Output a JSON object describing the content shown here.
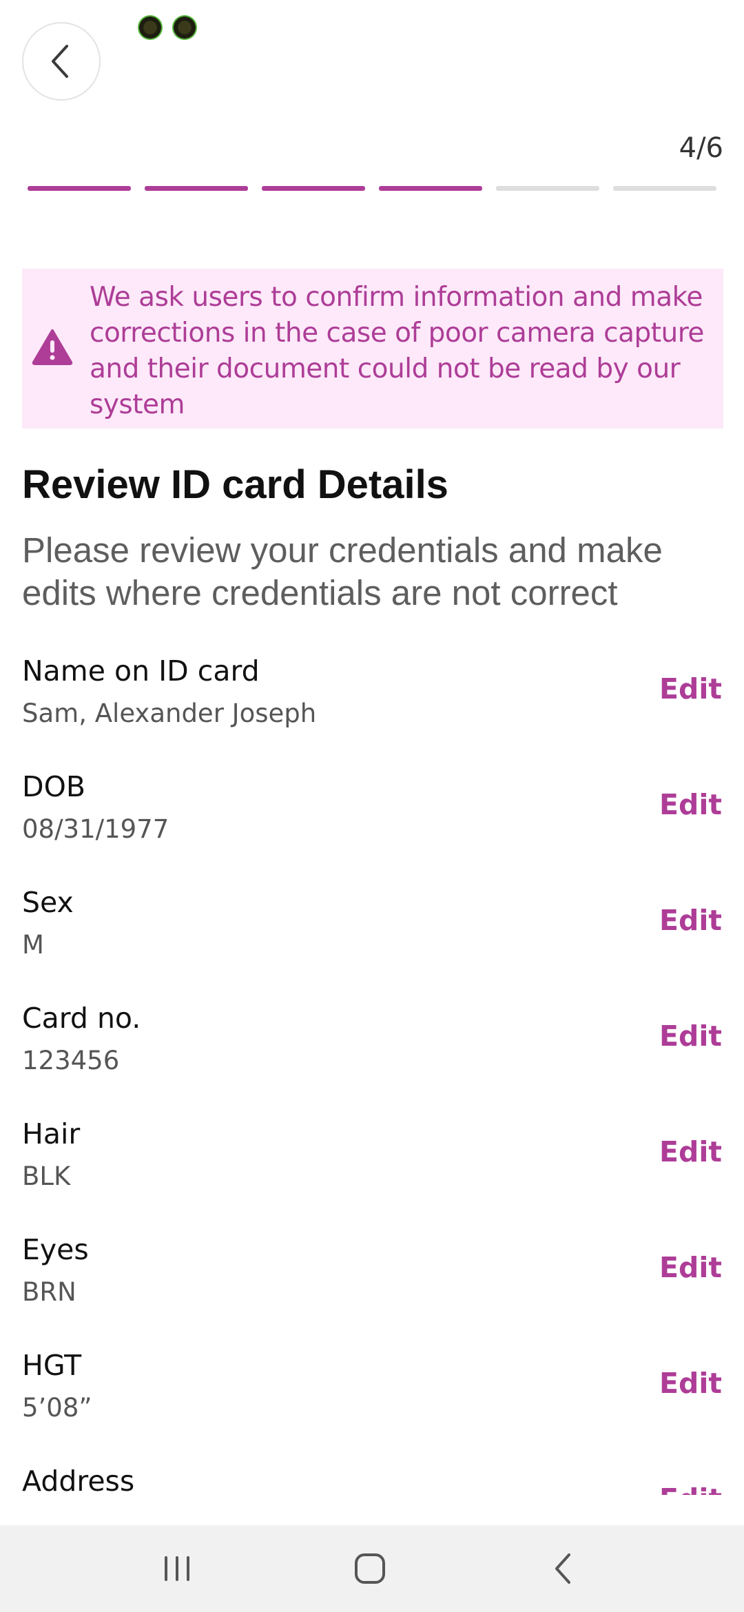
{
  "header": {
    "step_counter": "4/6",
    "progress": {
      "total_steps": 6,
      "completed_steps": 4
    }
  },
  "notice": {
    "icon": "warning-triangle-icon",
    "text": "We ask users to confirm information and make corrections in the case of poor camera capture and their document could not be read by our system"
  },
  "main": {
    "title": "Review ID card Details",
    "subtitle": "Please review your credentials and make edits where credentials are not correct",
    "fields": [
      {
        "label": "Name on ID card",
        "value": "Sam, Alexander Joseph",
        "edit_label": "Edit"
      },
      {
        "label": "DOB",
        "value": "08/31/1977",
        "edit_label": "Edit"
      },
      {
        "label": "Sex",
        "value": "M",
        "edit_label": "Edit"
      },
      {
        "label": "Card no.",
        "value": "123456",
        "edit_label": "Edit"
      },
      {
        "label": "Hair",
        "value": "BLK",
        "edit_label": "Edit"
      },
      {
        "label": "Eyes",
        "value": "BRN",
        "edit_label": "Edit"
      },
      {
        "label": "HGT",
        "value": "5’08”",
        "edit_label": "Edit"
      },
      {
        "label": "Address",
        "value": "",
        "edit_label": "Edit"
      }
    ]
  },
  "colors": {
    "accent": "#ad3d97",
    "notice_bg": "#fde9f9",
    "progress_inactive": "#dedede",
    "nav_bar_bg": "#f1f1f1"
  }
}
